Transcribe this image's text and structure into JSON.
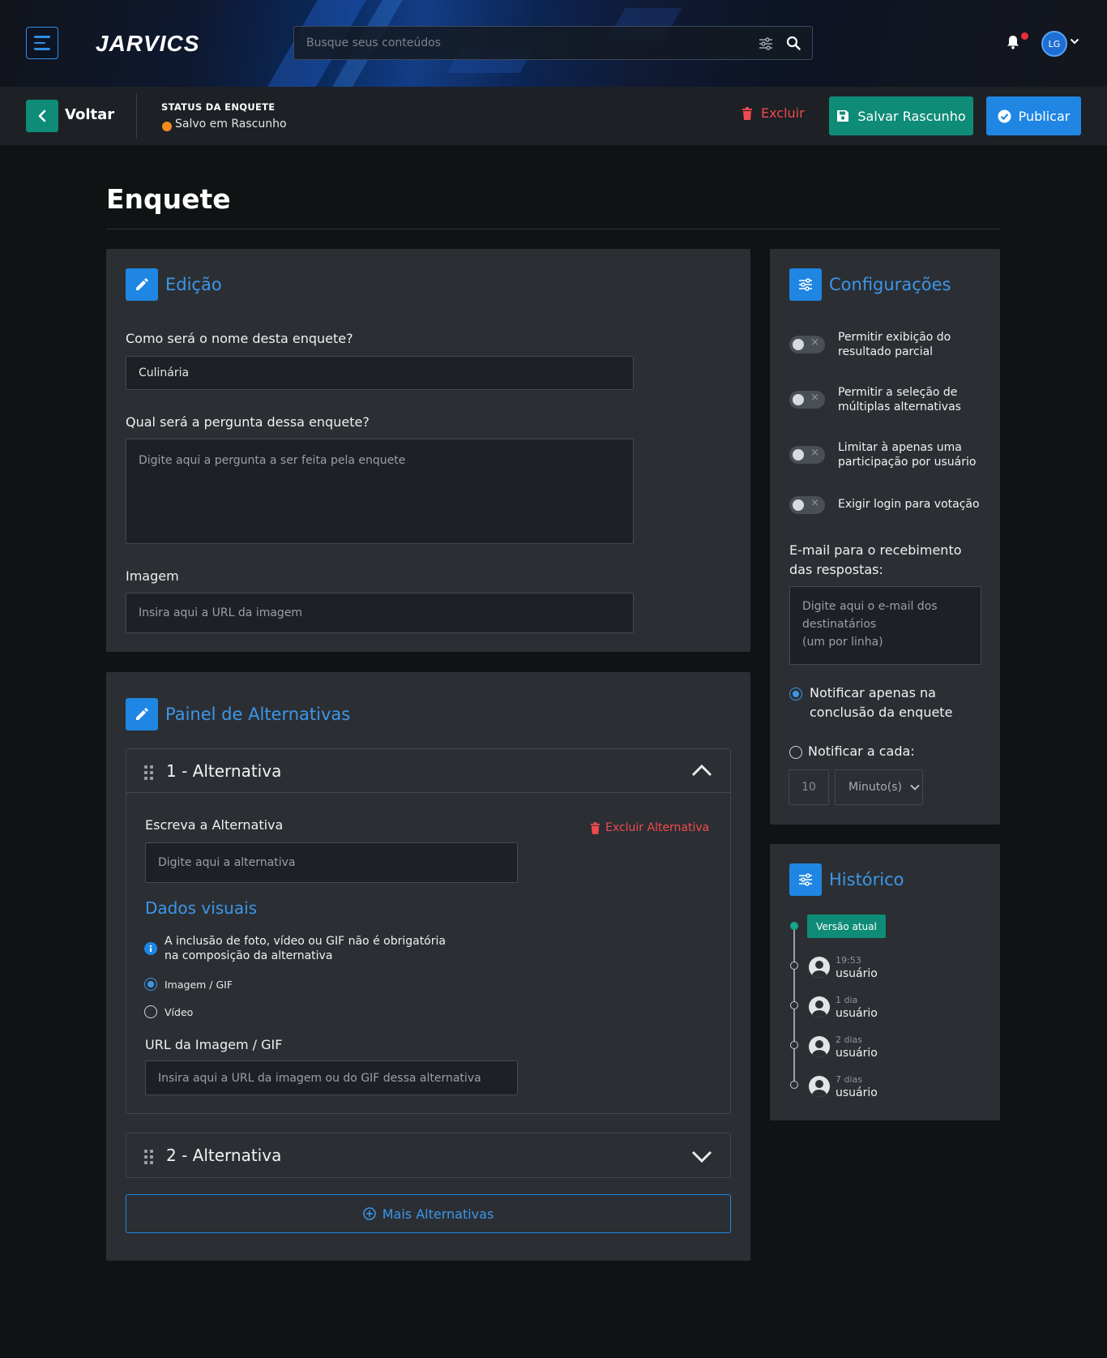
{
  "header": {
    "logo": "JARVICS",
    "search_placeholder": "Busque seus conteúdos",
    "avatar_initials": "LG"
  },
  "action_bar": {
    "back_label": "Voltar",
    "status_title": "STATUS DA ENQUETE",
    "status_value": "Salvo em Rascunho",
    "status_color": "#f28b1e",
    "delete_label": "Excluir",
    "save_draft_label": "Salvar Rascunho",
    "publish_label": "Publicar"
  },
  "page": {
    "title": "Enquete"
  },
  "edicao": {
    "title": "Edição",
    "name_label": "Como será o nome desta enquete?",
    "name_value": "Culinária",
    "question_label": "Qual será a pergunta dessa enquete?",
    "question_placeholder": "Digite aqui a pergunta a ser feita pela enquete",
    "image_label": "Imagem",
    "image_placeholder": "Insira aqui a URL da imagem"
  },
  "alternativas": {
    "title": "Painel de Alternativas",
    "items": [
      {
        "title": "1 - Alternativa",
        "expanded": true,
        "write_label": "Escreva a Alternativa",
        "delete_label": "Excluir Alternativa",
        "input_placeholder": "Digite aqui a alternativa",
        "visual_title": "Dados visuais",
        "info_line1": "A inclusão de foto, vídeo ou GIF não é obrigatória",
        "info_line2": "na composição da alternativa",
        "media_options": [
          "Imagem / GIF",
          "Vídeo"
        ],
        "media_selected": "Imagem / GIF",
        "url_label": "URL da Imagem / GIF",
        "url_placeholder": "Insira aqui a URL da imagem ou do GIF dessa alternativa"
      },
      {
        "title": "2 - Alternativa",
        "expanded": false
      }
    ],
    "more_label": "Mais Alternativas"
  },
  "configuracoes": {
    "title": "Configurações",
    "toggles": [
      {
        "line1": "Permitir exibição do",
        "line2": "resultado parcial",
        "on": false
      },
      {
        "line1": "Permitir a seleção de",
        "line2": "múltiplas alternativas",
        "on": false
      },
      {
        "line1": "Limitar à apenas uma",
        "line2": "participação por usuário",
        "on": false
      },
      {
        "line1": "Exigir login para votação",
        "line2": "",
        "on": false
      }
    ],
    "email_label_line1": "E-mail para o recebimento",
    "email_label_line2": "das respostas:",
    "email_placeholder_line1": "Digite aqui o e-mail dos",
    "email_placeholder_line2": "destinatários",
    "email_placeholder_line3": "(um por linha)",
    "notify_conclusion_line1": "Notificar apenas na",
    "notify_conclusion_line2": "conclusão da enquete",
    "notify_every": "Notificar a cada:",
    "notify_selected": "conclusion",
    "interval_value": "10",
    "interval_unit": "Minuto(s)"
  },
  "historico": {
    "title": "Histórico",
    "current_label": "Versão atual",
    "entries": [
      {
        "time": "19:53",
        "user": "usuário"
      },
      {
        "time": "1 dia",
        "user": "usuário"
      },
      {
        "time": "2 dias",
        "user": "usuário"
      },
      {
        "time": "7 dias",
        "user": "usuário"
      }
    ]
  }
}
